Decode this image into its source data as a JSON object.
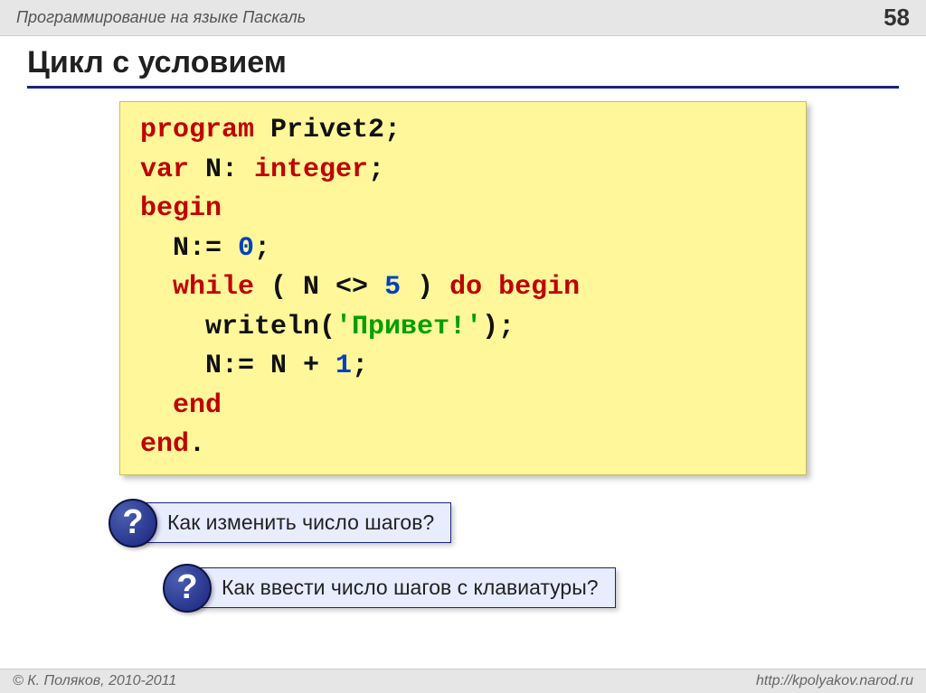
{
  "header": {
    "title": "Программирование на языке Паскаль",
    "page_number": "58"
  },
  "slide": {
    "title": "Цикл с условием"
  },
  "code": {
    "l1a": "program",
    "l1b": " Privet2;",
    "l2a": "var",
    "l2b": " N: ",
    "l2c": "integer",
    "l2d": ";",
    "l3": "begin",
    "l4a": "  N:= ",
    "l4b": "0",
    "l4c": ";",
    "l5a": "  ",
    "l5b": "while",
    "l5c": " ( N <> ",
    "l5d": "5",
    "l5e": " ) ",
    "l5f": "do begin",
    "l6a": "    writeln(",
    "l6b": "'Привет!'",
    "l6c": ");",
    "l7a": "    N:= N + ",
    "l7b": "1",
    "l7c": ";",
    "l8a": "  ",
    "l8b": "end",
    "l9a": "end",
    "l9b": "."
  },
  "questions": {
    "q_mark": "?",
    "q1": "Как изменить число шагов?",
    "q2": "Как ввести число шагов с клавиатуры?"
  },
  "footer": {
    "copyright": "© К. Поляков, 2010-2011",
    "url": "http://kpolyakov.narod.ru"
  }
}
